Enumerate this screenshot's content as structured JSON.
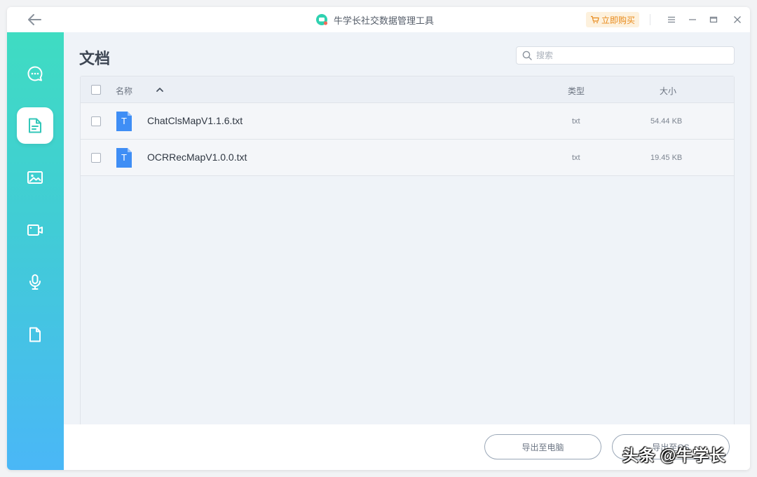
{
  "app": {
    "title": "牛学长社交数据管理工具",
    "buy_label": "立即购买"
  },
  "sidebar": {
    "items": [
      {
        "name": "chat",
        "icon": "chat-bubble-icon",
        "active": false
      },
      {
        "name": "documents",
        "icon": "document-icon",
        "active": true
      },
      {
        "name": "photos",
        "icon": "image-icon",
        "active": false
      },
      {
        "name": "videos",
        "icon": "video-icon",
        "active": false
      },
      {
        "name": "audio",
        "icon": "microphone-icon",
        "active": false
      },
      {
        "name": "files",
        "icon": "file-icon",
        "active": false
      }
    ]
  },
  "page": {
    "title": "文档"
  },
  "search": {
    "placeholder": "搜索"
  },
  "table": {
    "columns": {
      "name": "名称",
      "type": "类型",
      "size": "大小"
    },
    "rows": [
      {
        "name": "ChatClsMapV1.1.6.txt",
        "type": "txt",
        "size": "54.44 KB",
        "icon_letter": "T"
      },
      {
        "name": "OCRRecMapV1.0.0.txt",
        "type": "txt",
        "size": "19.45 KB",
        "icon_letter": "T"
      }
    ]
  },
  "footer": {
    "export_pc_label": "导出至电脑",
    "export_other_label": "导出至OS"
  },
  "watermark": "头条 @牛学长",
  "colors": {
    "accent_gradient_top": "#3fdcc2",
    "accent_gradient_bottom": "#4ab7f7",
    "file_icon_blue": "#3f8ef5",
    "buy_orange": "#e88a1b"
  }
}
